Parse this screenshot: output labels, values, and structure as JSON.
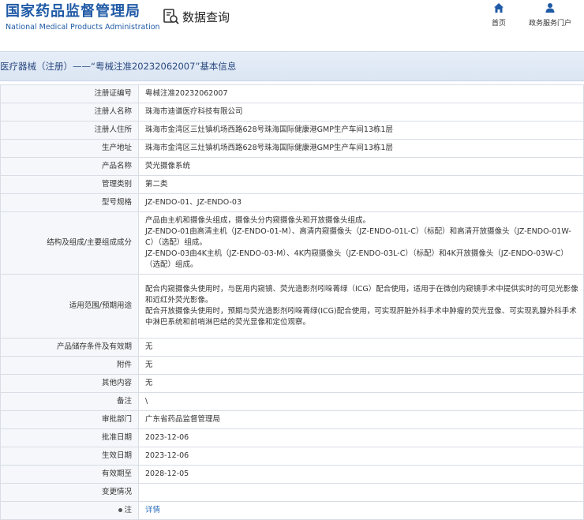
{
  "header": {
    "brand_cn": "国家药品监督管理局",
    "brand_en": "National Medical Products Administration",
    "section_label": "数据查询",
    "nav": [
      {
        "label": "首页",
        "icon": "home-icon"
      },
      {
        "label": "政务服务门户",
        "icon": "person-icon"
      }
    ]
  },
  "title_bar": "医疗器械（注册）——“粤械注准20232062007”基本信息",
  "table": {
    "rows": [
      {
        "label": "注册证编号",
        "value": "粤械注准20232062007"
      },
      {
        "label": "注册人名称",
        "value": "珠海市迪谱医疗科技有限公司"
      },
      {
        "label": "注册人住所",
        "value": "珠海市金湾区三灶镇机场西路628号珠海国际健康港GMP生产车间13栋1层"
      },
      {
        "label": "生产地址",
        "value": "珠海市金湾区三灶镇机场西路628号珠海国际健康港GMP生产车间13栋1层"
      },
      {
        "label": "产品名称",
        "value": "荧光摄像系统"
      },
      {
        "label": "管理类别",
        "value": "第二类"
      },
      {
        "label": "型号规格",
        "value": "JZ-ENDO-01、JZ-ENDO-03"
      },
      {
        "label": "结构及组成/主要组成成分",
        "value_lines": [
          "产品由主机和摄像头组成，摄像头分内窥摄像头和开放摄像头组成。",
          "JZ-ENDO-01由高清主机（JZ-ENDO-01-M）、高清内窥摄像头（JZ-ENDO-01L-C）（标配）和高清开放摄像头（JZ-ENDO-01W-C）（选配）组成。",
          "JZ-ENDO-03由4K主机（JZ-ENDO-03-M）、4K内窥摄像头（JZ-ENDO-03L-C）（标配）和4K开放摄像头（JZ-ENDO-03W-C）（选配）组成。"
        ]
      },
      {
        "label": "适用范围/预期用途",
        "value_lines": [
          "配合内窥摄像头使用时，与医用内窥镜、荧光造影剂吲哚菁绿（ICG）配合使用，适用于在微创内窥镜手术中提供实时的可见光影像和近红外荧光影像。",
          "配合开放摄像头使用时，预期与荧光造影剂吲哚菁绿(ICG)配合使用，可实现肝脏外科手术中肿瘤的荧光显像、可实现乳腺外科手术中淋巴系统和前哨淋巴结的荧光显像和定位观察。"
        ]
      },
      {
        "label": "产品储存条件及有效期",
        "value": "无"
      },
      {
        "label": "附件",
        "value": "无"
      },
      {
        "label": "其他内容",
        "value": "无"
      },
      {
        "label": "备注",
        "value": "\\"
      },
      {
        "label": "审批部门",
        "value": "广东省药品监督管理局"
      },
      {
        "label": "批准日期",
        "value": "2023-12-06"
      },
      {
        "label": "生效日期",
        "value": "2023-12-06"
      },
      {
        "label": "有效期至",
        "value": "2028-12-05"
      },
      {
        "label": "变更情况",
        "value": ""
      },
      {
        "label": "注",
        "value": "详情"
      }
    ]
  }
}
